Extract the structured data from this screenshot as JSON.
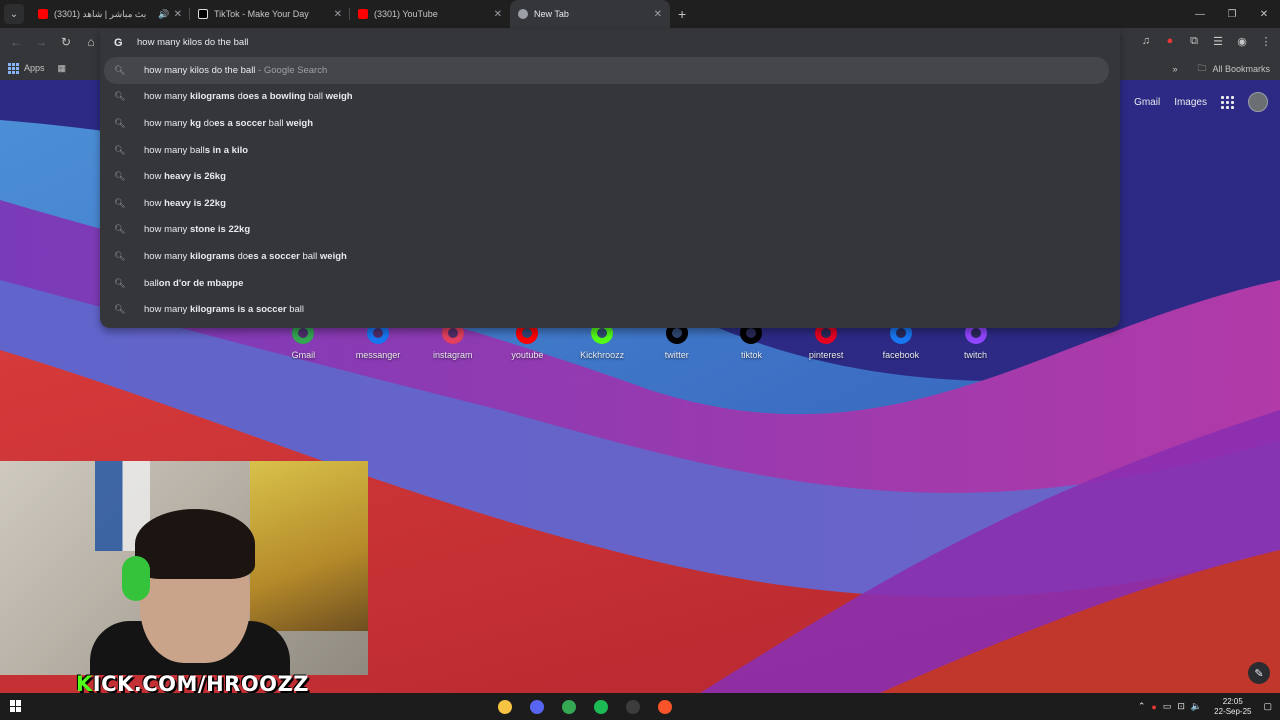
{
  "browser": {
    "tabs": [
      {
        "title": "بث مباشر | شاهد (3301)",
        "favicon_color": "#ff0000",
        "active": false,
        "has_audio": true
      },
      {
        "title": "TikTok - Make Your Day",
        "favicon_color": "#ffffff",
        "active": false,
        "has_audio": false
      },
      {
        "title": "(3301) YouTube",
        "favicon_color": "#ff0000",
        "active": false,
        "has_audio": false
      },
      {
        "title": "New Tab",
        "favicon_color": "#9aa0a6",
        "active": true,
        "has_audio": false
      }
    ],
    "omnibox": {
      "value": "how many kilos do the ball",
      "provider_icon": "G"
    },
    "bookmarks": {
      "apps_label": "Apps",
      "all_bookmarks_label": "All Bookmarks"
    }
  },
  "suggestions": [
    {
      "prefix": "how many kilos do the ball",
      "bold": "",
      "suffix": "",
      "tail": " - Google Search",
      "selected": true
    },
    {
      "parts": [
        [
          "how many ",
          false
        ],
        [
          "kilograms",
          true
        ],
        [
          " d",
          false
        ],
        [
          "oes a bowling",
          true
        ],
        [
          " ball ",
          false
        ],
        [
          "weigh",
          true
        ]
      ]
    },
    {
      "parts": [
        [
          "how many ",
          false
        ],
        [
          "kg",
          true
        ],
        [
          " do",
          false
        ],
        [
          "es a soccer",
          true
        ],
        [
          " ball ",
          false
        ],
        [
          "weigh",
          true
        ]
      ]
    },
    {
      "parts": [
        [
          "how many ball",
          false
        ],
        [
          "s in a kilo",
          true
        ]
      ]
    },
    {
      "parts": [
        [
          "how ",
          false
        ],
        [
          "heavy is 26kg",
          true
        ]
      ]
    },
    {
      "parts": [
        [
          "how ",
          false
        ],
        [
          "heavy is 22kg",
          true
        ]
      ]
    },
    {
      "parts": [
        [
          "how many ",
          false
        ],
        [
          "stone is 22kg",
          true
        ]
      ]
    },
    {
      "parts": [
        [
          "how many ",
          false
        ],
        [
          "kilograms",
          true
        ],
        [
          " do",
          false
        ],
        [
          "es a soccer",
          true
        ],
        [
          " ball ",
          false
        ],
        [
          "weigh",
          true
        ]
      ]
    },
    {
      "parts": [
        [
          "ball",
          false
        ],
        [
          "on d'or de mbappe",
          true
        ]
      ]
    },
    {
      "parts": [
        [
          "how many ",
          false
        ],
        [
          "kilograms is a soccer",
          true
        ],
        [
          " ball",
          false
        ]
      ]
    }
  ],
  "google_header": {
    "gmail": "Gmail",
    "images": "Images"
  },
  "shortcuts": [
    {
      "label": "Gmail",
      "color": "#34a853"
    },
    {
      "label": "messanger",
      "color": "#1877f2"
    },
    {
      "label": "instagram",
      "color": "#e4405f"
    },
    {
      "label": "youtube",
      "color": "#ff0000"
    },
    {
      "label": "Kickhroozz",
      "color": "#53fc18"
    },
    {
      "label": "twitter",
      "color": "#000000"
    },
    {
      "label": "tiktok",
      "color": "#000000"
    },
    {
      "label": "pinterest",
      "color": "#e60023"
    },
    {
      "label": "facebook",
      "color": "#1877f2"
    },
    {
      "label": "twitch",
      "color": "#9146ff"
    }
  ],
  "stream_overlay": {
    "k": "K",
    "rest": "ICK.COM/HROOZZ"
  },
  "taskbar": {
    "time": "22:05",
    "date": "22-Sep-25",
    "apps": [
      {
        "name": "file-explorer",
        "color": "#f6c343"
      },
      {
        "name": "discord-like",
        "color": "#5865f2"
      },
      {
        "name": "chrome",
        "color": "#34a853"
      },
      {
        "name": "spotify",
        "color": "#1db954"
      },
      {
        "name": "obs",
        "color": "#3c3c3c"
      },
      {
        "name": "brave",
        "color": "#fb542b"
      }
    ]
  }
}
